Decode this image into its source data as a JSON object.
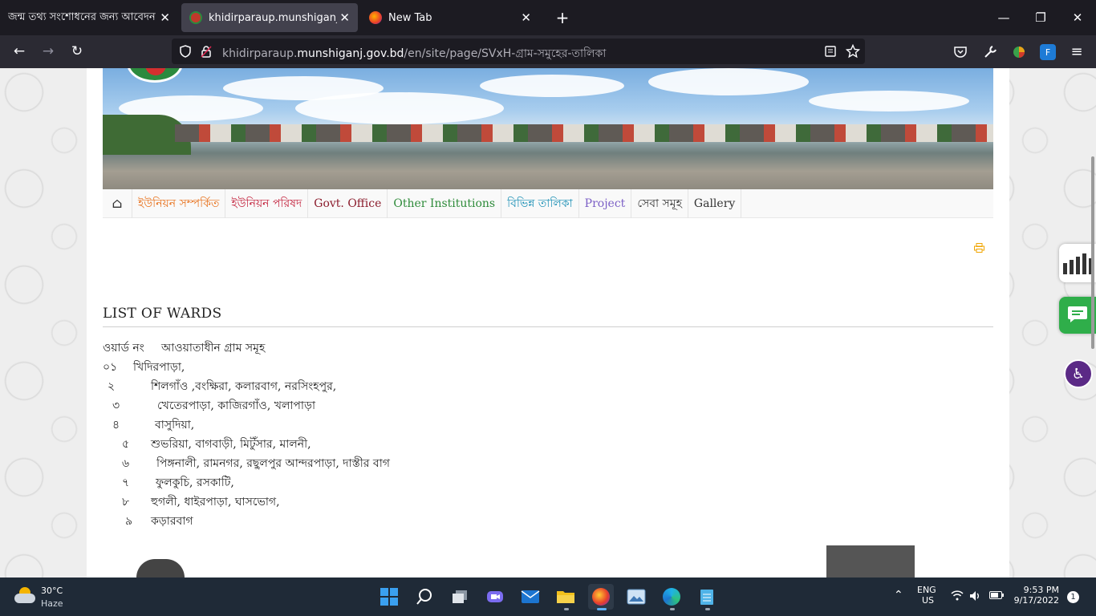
{
  "browser": {
    "tabs": [
      {
        "title": "জন্ম তথ্য সংশোধনের জন্য আবেদন",
        "close": "✕"
      },
      {
        "title": "khidirparaup.munshiganj.gov.bd",
        "close": "✕"
      },
      {
        "title": "New Tab",
        "close": "✕"
      }
    ],
    "new_tab": "+",
    "url_prefix": "khidirparaup.",
    "url_domain": "munshiganj.gov.bd",
    "url_path": "/en/site/page/SVxH-গ্রাম-সমুহের-তালিকা",
    "window_controls": {
      "minimize": "—",
      "maximize": "❐",
      "close": "✕"
    },
    "nav": {
      "back": "←",
      "forward": "→",
      "reload": "↻"
    }
  },
  "site": {
    "menu": [
      {
        "label": "ইউনিয়ন সম্পর্কিত",
        "color": "#e8701a"
      },
      {
        "label": "ইউনিয়ন পরিষদ",
        "color": "#c21f3a"
      },
      {
        "label": "Govt. Office",
        "color": "#8b1c2c"
      },
      {
        "label": "Other Institutions",
        "color": "#2e8b3a"
      },
      {
        "label": "বিভিন্ন তালিকা",
        "color": "#1a8fb5"
      },
      {
        "label": "Project",
        "color": "#7b5fc6"
      },
      {
        "label": "সেবা সমূহ",
        "color": "#333333"
      },
      {
        "label": "Gallery",
        "color": "#333333"
      }
    ],
    "print_icon": "print-icon",
    "page_title": "LIST OF WARDS",
    "table_header": {
      "col1": "ওয়ার্ড নং",
      "col2": "আওয়াতাধীন গ্রাম সমূহ"
    },
    "wards": [
      {
        "no": "০১",
        "villages": "খিদিরপাড়া,"
      },
      {
        "no": "২",
        "villages": "শিলগাঁও ,বংক্ষিরা, কলারবাগ, নরসিংহপুর,"
      },
      {
        "no": "৩",
        "villages": "খেতেরপাড়া, কাজিরগাঁও, খলাপাড়া"
      },
      {
        "no": "৪",
        "villages": "বাসুদিয়া,"
      },
      {
        "no": "৫",
        "villages": "শুভরিয়া, বাগবাড়ী, মিটুঁসার, মালনী,"
      },
      {
        "no": "৬",
        "villages": "পিঙ্গনালী, রামনগর, রছুলপুর আন্দরপাড়া, দাস্তীর বাগ"
      },
      {
        "no": "৭",
        "villages": "ফুলকুচি, রসকাটি,"
      },
      {
        "no": "৮",
        "villages": "হুগলী, ধাইরপাড়া, ঘাসভোগ,"
      },
      {
        "no": "৯",
        "villages": "কড়ারবাগ"
      }
    ]
  },
  "taskbar": {
    "weather_temp": "30°C",
    "weather_desc": "Haze",
    "lang1": "ENG",
    "lang2": "US",
    "time": "9:53 PM",
    "date": "9/17/2022",
    "notifications": "1"
  }
}
